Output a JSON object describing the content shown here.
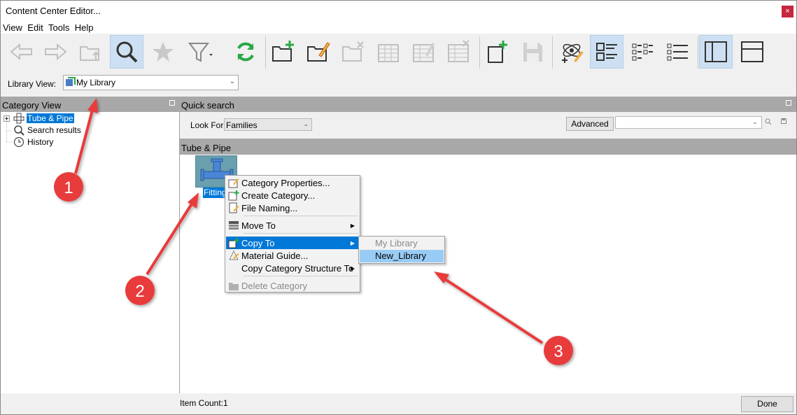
{
  "window": {
    "title": "Content Center Editor...",
    "close_glyph": "×"
  },
  "menu": [
    "View",
    "Edit",
    "Tools",
    "Help"
  ],
  "toolbar": {
    "buttons": [
      {
        "icon": "back-arrow-icon"
      },
      {
        "icon": "forward-arrow-icon"
      },
      {
        "icon": "up-folder-icon"
      },
      {
        "icon": "search-icon",
        "active": true
      },
      {
        "icon": "favorites-star-icon"
      },
      {
        "icon": "filter-icon"
      },
      {
        "icon": "refresh-icon"
      },
      {
        "icon": "new-category-icon"
      },
      {
        "icon": "edit-category-icon"
      },
      {
        "icon": "delete-category-icon"
      },
      {
        "icon": "family-table-icon"
      },
      {
        "icon": "edit-family-icon"
      },
      {
        "icon": "delete-family-icon"
      },
      {
        "icon": "new-window-icon"
      },
      {
        "icon": "save-icon"
      },
      {
        "icon": "publish-icon"
      },
      {
        "icon": "large-icons-view-icon",
        "active": true
      },
      {
        "icon": "small-icons-view-icon"
      },
      {
        "icon": "list-view-icon"
      },
      {
        "icon": "split-vertical-icon",
        "active": true
      },
      {
        "icon": "split-horizontal-icon"
      }
    ]
  },
  "library_view": {
    "label": "Library View:",
    "selected": "My Library"
  },
  "category_view": {
    "title": "Category View",
    "tree": [
      {
        "label": "Tube & Pipe",
        "selected": true,
        "icon": "tube-pipe-icon"
      },
      {
        "label": "Search results",
        "icon": "search-results-icon"
      },
      {
        "label": "History",
        "icon": "history-clock-icon"
      }
    ]
  },
  "quick_search": {
    "title": "Quick search",
    "look_for_label": "Look For:",
    "look_for_value": "Families",
    "advanced_label": "Advanced",
    "search_value": ""
  },
  "content_header": "Tube & Pipe",
  "items": [
    {
      "label": "Fitting",
      "icon": "fittings-folder-icon"
    }
  ],
  "context_menu": {
    "items": [
      {
        "label": "Category Properties...",
        "icon": "category-properties-icon"
      },
      {
        "label": "Create Category...",
        "icon": "create-category-icon"
      },
      {
        "label": "File Naming...",
        "icon": "file-naming-icon"
      },
      {
        "label": "Move To",
        "icon": "move-to-icon",
        "submenu": true
      },
      {
        "label": "Copy To",
        "icon": "copy-to-icon",
        "submenu": true,
        "highlighted": true
      },
      {
        "label": "Material Guide...",
        "icon": "material-guide-icon"
      },
      {
        "label": "Copy Category Structure To",
        "submenu": true
      },
      {
        "label": "Delete Category",
        "icon": "delete-category-icon",
        "disabled": true
      }
    ],
    "submenu_glyph": "▶"
  },
  "copy_to_submenu": [
    {
      "label": "My Library",
      "disabled": true
    },
    {
      "label": "New_Library",
      "highlighted": true
    }
  ],
  "status": {
    "item_count": "Item Count:1",
    "done_label": "Done"
  },
  "annotations": [
    {
      "number": "1"
    },
    {
      "number": "2"
    },
    {
      "number": "3"
    }
  ],
  "colors": {
    "selection": "#0078d7",
    "annotation_red": "#e83a3a",
    "panel_header": "#a8a8a8"
  }
}
